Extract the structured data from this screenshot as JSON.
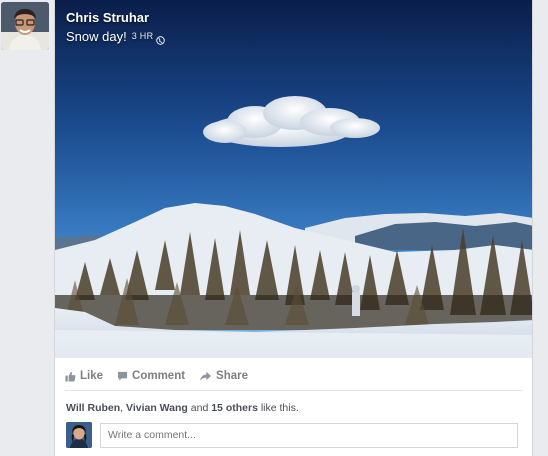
{
  "post": {
    "author": "Chris Struhar",
    "status": "Snow day!",
    "time": "3 HR",
    "privacy_icon": "globe-icon"
  },
  "actions": {
    "like_label": "Like",
    "comment_label": "Comment",
    "share_label": "Share"
  },
  "likes": {
    "name1": "Will Ruben",
    "sep1": ", ",
    "name2": "Vivian Wang",
    "and": " and ",
    "others": "15 others",
    "suffix": " like this."
  },
  "comment": {
    "placeholder": "Write a comment..."
  },
  "colors": {
    "background": "#e9ebee",
    "action_text": "#7f7f7f",
    "link_text": "#4b4f56"
  }
}
